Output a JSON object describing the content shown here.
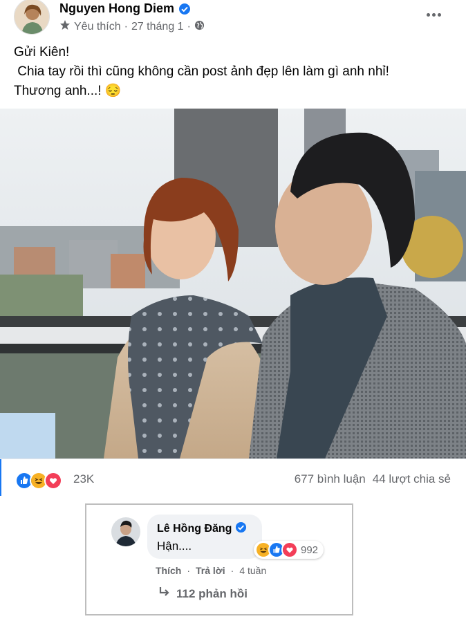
{
  "post": {
    "author": "Nguyen Hong Diem",
    "meta_label": "Yêu thích",
    "meta_date": "27 tháng 1",
    "meta_sep": "·",
    "lines": [
      "Gửi Kiên!",
      " Chia tay rồi thì cũng không cần post ảnh đẹp lên làm gì anh nhỉ!",
      "Thương anh...! 😔"
    ],
    "reaction_count": "23K",
    "comments_text": "677 bình luận",
    "shares_text": "44 lượt chia sẻ",
    "reaction_icons": [
      "like-icon",
      "haha-icon",
      "love-icon"
    ]
  },
  "comment": {
    "author": "Lê Hồng Đăng",
    "text": "Hận....",
    "reaction_count": "992",
    "like_label": "Thích",
    "reply_label": "Trả lời",
    "time": "4 tuần",
    "replies_text": "112 phản hồi",
    "reaction_icons": [
      "haha-icon",
      "like-icon",
      "love-icon"
    ]
  },
  "colors": {
    "accent": "#1877f2",
    "secondary_text": "#65676b",
    "love": "#f33e58",
    "haha": "#f7b125"
  }
}
